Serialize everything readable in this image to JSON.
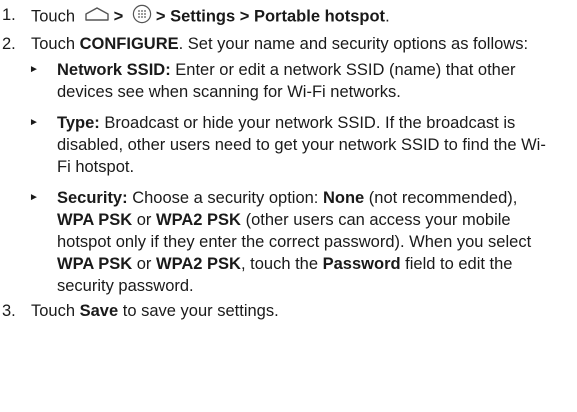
{
  "steps": [
    {
      "number": "1.",
      "text": {
        "touch": "Touch",
        "sep1": ">",
        "sep2": "> Settings > Portable hotspot",
        "end": "."
      },
      "icons": [
        "home-icon",
        "apps-icon"
      ]
    },
    {
      "number": "2.",
      "text": {
        "touch": "Touch",
        "configure": "CONFIGURE",
        "rest": ". Set your name and security options as follows:"
      },
      "bullets": [
        {
          "marker": "►",
          "label": "Network SSID:",
          "text": " Enter or edit a network SSID (name) that other devices see when scanning for Wi-Fi networks."
        },
        {
          "marker": "►",
          "label": "Type:",
          "text": " Broadcast or hide your network SSID. If the broadcast is disabled, other users need to get your network SSID to find the Wi-Fi hotspot."
        },
        {
          "marker": "►",
          "label": "Security:",
          "t1": " Choose a security option: ",
          "none": "None",
          "t2": " (not recommended), ",
          "wpa": "WPA PSK",
          "t3": " or ",
          "wpa2": "WPA2 PSK",
          "t4": " (other users can access your mobile hotspot only if they enter the correct password). When you select ",
          "wpa_b": "WPA PSK",
          "t5": " or ",
          "wpa2_b": "WPA2 PSK",
          "t6": ", touch the ",
          "password": "Password",
          "t7": " field to edit the security password."
        }
      ]
    },
    {
      "number": "3.",
      "text": {
        "touch": "Touch",
        "save": "Save",
        "rest": " to save your settings."
      }
    }
  ]
}
